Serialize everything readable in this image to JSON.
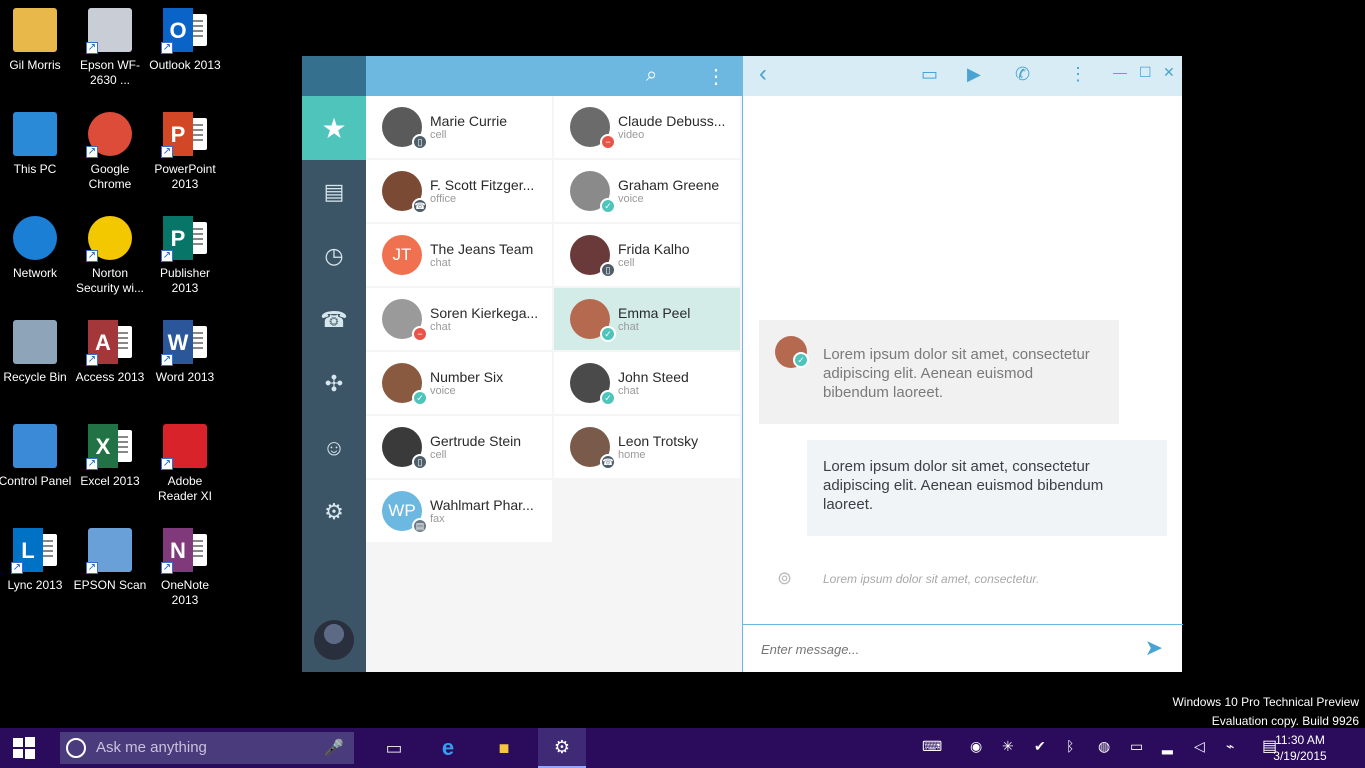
{
  "desktop": {
    "icons": [
      {
        "label": "Gil Morris",
        "icon": "user-folder-icon"
      },
      {
        "label": "Epson WF-2630 ...",
        "icon": "printer-icon"
      },
      {
        "label": "Outlook 2013",
        "icon": "outlook-icon"
      },
      {
        "label": "This PC",
        "icon": "computer-icon"
      },
      {
        "label": "Google Chrome",
        "icon": "chrome-icon"
      },
      {
        "label": "PowerPoint 2013",
        "icon": "powerpoint-icon"
      },
      {
        "label": "Network",
        "icon": "network-icon"
      },
      {
        "label": "Norton Security wi...",
        "icon": "norton-icon"
      },
      {
        "label": "Publisher 2013",
        "icon": "publisher-icon"
      },
      {
        "label": "Recycle Bin",
        "icon": "recycle-bin-icon"
      },
      {
        "label": "Access 2013",
        "icon": "access-icon"
      },
      {
        "label": "Word 2013",
        "icon": "word-icon"
      },
      {
        "label": "Control Panel",
        "icon": "control-panel-icon"
      },
      {
        "label": "Excel 2013",
        "icon": "excel-icon"
      },
      {
        "label": "Adobe Reader XI",
        "icon": "adobe-reader-icon"
      },
      {
        "label": "Lync 2013",
        "icon": "lync-icon"
      },
      {
        "label": "EPSON Scan",
        "icon": "scanner-icon"
      },
      {
        "label": "OneNote 2013",
        "icon": "onenote-icon"
      }
    ],
    "watermark_line1": "Windows 10 Pro Technical Preview",
    "watermark_line2": "Evaluation copy. Build 9926"
  },
  "app": {
    "accent": "#4ec4ba",
    "rail": [
      "star-icon",
      "contact-card-icon",
      "history-icon",
      "dialpad-icon",
      "network-share-icon",
      "group-icon",
      "settings-icon"
    ],
    "contacts": [
      {
        "name": "Marie Currie",
        "sub": "cell",
        "initials": "",
        "color": "#5a5a5a",
        "status": "cell",
        "selected": false
      },
      {
        "name": "Claude Debuss...",
        "sub": "video",
        "initials": "",
        "color": "#6b6b6b",
        "status": "busy",
        "selected": false
      },
      {
        "name": "F. Scott Fitzger...",
        "sub": "office",
        "initials": "",
        "color": "#7a4a35",
        "status": "office",
        "selected": false
      },
      {
        "name": "Graham Greene",
        "sub": "voice",
        "initials": "",
        "color": "#8a8a8a",
        "status": "online",
        "selected": false
      },
      {
        "name": "The Jeans Team",
        "sub": "chat",
        "initials": "JT",
        "color": "#f0714f",
        "status": "",
        "selected": false
      },
      {
        "name": "Frida Kalho",
        "sub": "cell",
        "initials": "",
        "color": "#6a3a3a",
        "status": "cell",
        "selected": false
      },
      {
        "name": "Soren Kierkega...",
        "sub": "chat",
        "initials": "",
        "color": "#9a9a9a",
        "status": "busy",
        "selected": false
      },
      {
        "name": "Emma Peel",
        "sub": "chat",
        "initials": "",
        "color": "#b56a4f",
        "status": "online",
        "selected": true
      },
      {
        "name": "Number Six",
        "sub": "voice",
        "initials": "",
        "color": "#8a5a40",
        "status": "online",
        "selected": false
      },
      {
        "name": "John Steed",
        "sub": "chat",
        "initials": "",
        "color": "#4a4a4a",
        "status": "online",
        "selected": false
      },
      {
        "name": "Gertrude Stein",
        "sub": "cell",
        "initials": "",
        "color": "#3a3a3a",
        "status": "cell",
        "selected": false
      },
      {
        "name": "Leon Trotsky",
        "sub": "home",
        "initials": "",
        "color": "#7a5a4a",
        "status": "office",
        "selected": false
      },
      {
        "name": "Wahlmart Phar...",
        "sub": "fax",
        "initials": "WP",
        "color": "#6db8e0",
        "status": "fax",
        "selected": false
      }
    ],
    "chat": {
      "incoming": "Lorem ipsum dolor sit amet, consectetur adipiscing elit. Aenean euismod bibendum laoreet.",
      "outgoing": "Lorem ipsum dolor sit amet, consectetur adipiscing elit. Aenean euismod bibendum laoreet.",
      "typing": "Lorem ipsum dolor sit amet, consectetur.",
      "placeholder": "Enter message..."
    }
  },
  "taskbar": {
    "search_placeholder": "Ask me anything",
    "time": "11:30 AM",
    "date": "3/19/2015"
  }
}
